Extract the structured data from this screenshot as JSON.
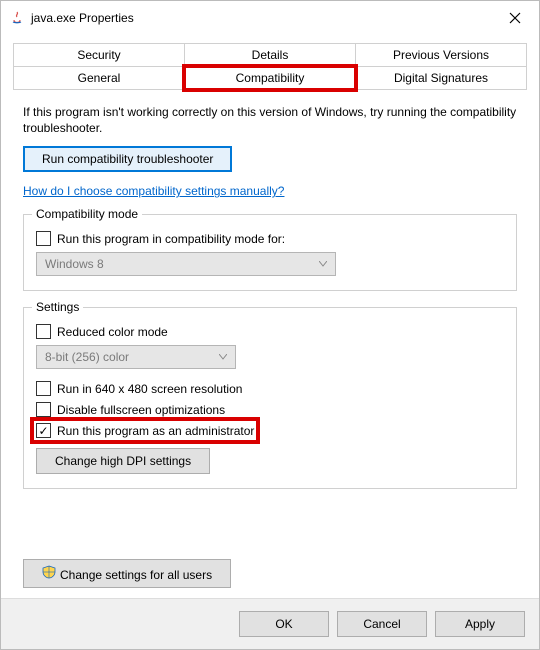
{
  "window": {
    "title": "java.exe Properties"
  },
  "tabs": {
    "row1": [
      "Security",
      "Details",
      "Previous Versions"
    ],
    "row2": [
      "General",
      "Compatibility",
      "Digital Signatures"
    ],
    "active": "Compatibility"
  },
  "intro": "If this program isn't working correctly on this version of Windows, try running the compatibility troubleshooter.",
  "troubleshooter_button": "Run compatibility troubleshooter",
  "help_link": "How do I choose compatibility settings manually?",
  "compat_mode": {
    "legend": "Compatibility mode",
    "checkbox_label": "Run this program in compatibility mode for:",
    "checked": false,
    "dropdown_value": "Windows 8"
  },
  "settings": {
    "legend": "Settings",
    "reduced_color": {
      "label": "Reduced color mode",
      "checked": false
    },
    "color_dropdown_value": "8-bit (256) color",
    "run_640": {
      "label": "Run in 640 x 480 screen resolution",
      "checked": false
    },
    "disable_fullscreen": {
      "label": "Disable fullscreen optimizations",
      "checked": false
    },
    "run_admin": {
      "label": "Run this program as an administrator",
      "checked": true
    },
    "dpi_button": "Change high DPI settings"
  },
  "all_users_button": "Change settings for all users",
  "dialog": {
    "ok": "OK",
    "cancel": "Cancel",
    "apply": "Apply"
  }
}
